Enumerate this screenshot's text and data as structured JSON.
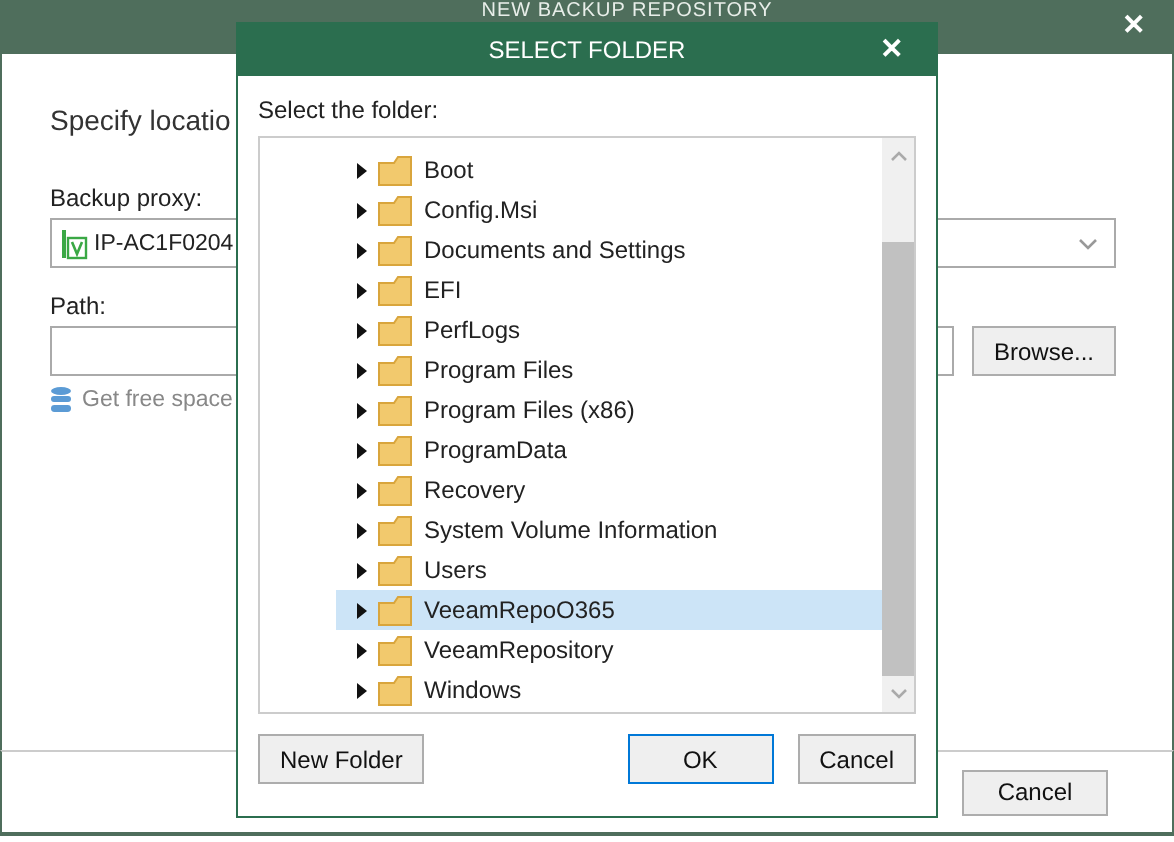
{
  "window": {
    "title": "NEW BACKUP REPOSITORY"
  },
  "page": {
    "heading": "Specify locatio",
    "proxy_label": "Backup proxy:",
    "proxy_value": "IP-AC1F0204",
    "path_label": "Path:",
    "browse_button": "Browse...",
    "free_space_link": "Get free space",
    "cancel_button": "Cancel"
  },
  "dialog": {
    "title": "SELECT FOLDER",
    "close": "✕",
    "prompt": "Select the folder:",
    "folders": [
      {
        "name": "Boot",
        "selected": false
      },
      {
        "name": "Config.Msi",
        "selected": false
      },
      {
        "name": "Documents and Settings",
        "selected": false
      },
      {
        "name": "EFI",
        "selected": false
      },
      {
        "name": "PerfLogs",
        "selected": false
      },
      {
        "name": "Program Files",
        "selected": false
      },
      {
        "name": "Program Files (x86)",
        "selected": false
      },
      {
        "name": "ProgramData",
        "selected": false
      },
      {
        "name": "Recovery",
        "selected": false
      },
      {
        "name": "System Volume Information",
        "selected": false
      },
      {
        "name": "Users",
        "selected": false
      },
      {
        "name": "VeeamRepoO365",
        "selected": true
      },
      {
        "name": "VeeamRepository",
        "selected": false
      },
      {
        "name": "Windows",
        "selected": false
      }
    ],
    "buttons": {
      "new_folder": "New Folder",
      "ok": "OK",
      "cancel": "Cancel"
    }
  },
  "main_close": "✕"
}
